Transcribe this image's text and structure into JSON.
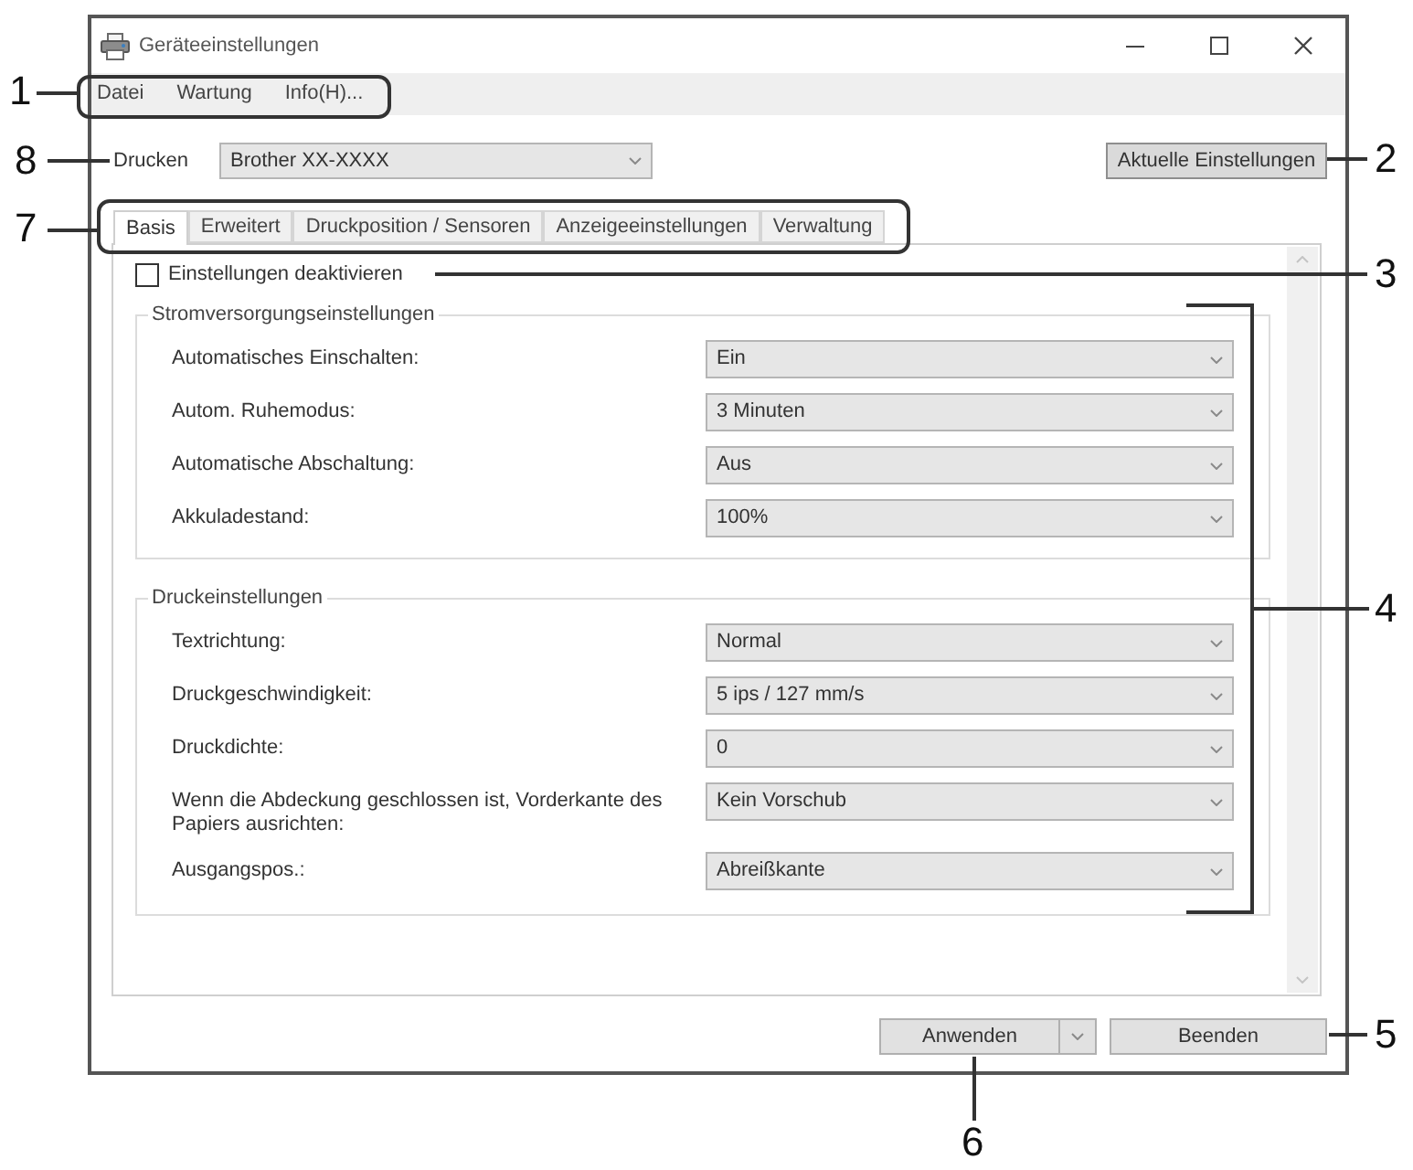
{
  "window": {
    "title": "Geräteeinstellungen"
  },
  "menu": [
    {
      "label": "Datei"
    },
    {
      "label": "Wartung"
    },
    {
      "label": "Info(H)..."
    }
  ],
  "printer": {
    "label": "Drucken",
    "value": "Brother XX-XXXX"
  },
  "current_settings_button": {
    "label": "Aktuelle Einstellungen"
  },
  "tabs": [
    {
      "label": "Basis",
      "selected": true
    },
    {
      "label": "Erweitert",
      "selected": false
    },
    {
      "label": "Druckposition / Sensoren",
      "selected": false
    },
    {
      "label": "Anzeigeeinstellungen",
      "selected": false
    },
    {
      "label": "Verwaltung",
      "selected": false
    }
  ],
  "disable_settings": {
    "label": "Einstellungen deaktivieren",
    "checked": false
  },
  "groups": [
    {
      "title": "Stromversorgungseinstellungen",
      "rows": [
        {
          "label": "Automatisches Einschalten:",
          "value": "Ein"
        },
        {
          "label": "Autom. Ruhemodus:",
          "value": "3 Minuten"
        },
        {
          "label": "Automatische Abschaltung:",
          "value": "Aus"
        },
        {
          "label": "Akkuladestand:",
          "value": "100%"
        }
      ]
    },
    {
      "title": "Druckeinstellungen",
      "rows": [
        {
          "label": "Textrichtung:",
          "value": "Normal"
        },
        {
          "label": "Druckgeschwindigkeit:",
          "value": "5 ips / 127 mm/s"
        },
        {
          "label": "Druckdichte:",
          "value": "0"
        },
        {
          "label": "Wenn die Abdeckung geschlossen ist, Vorderkante des Papiers ausrichten:",
          "value": "Kein Vorschub"
        },
        {
          "label": "Ausgangspos.:",
          "value": "Abreißkante"
        }
      ]
    }
  ],
  "buttons": [
    {
      "label": "Anwenden",
      "kind": "split"
    },
    {
      "label": "Beenden",
      "kind": "plain"
    }
  ],
  "callouts": [
    {
      "number": "1",
      "kind": "menu"
    },
    {
      "number": "8",
      "kind": "printer"
    },
    {
      "number": "2",
      "kind": "refresh"
    },
    {
      "number": "7",
      "kind": "tabs"
    },
    {
      "number": "3",
      "kind": "checkbox"
    },
    {
      "number": "4",
      "kind": "groups"
    },
    {
      "number": "5",
      "kind": "exit"
    },
    {
      "number": "6",
      "kind": "apply"
    }
  ]
}
